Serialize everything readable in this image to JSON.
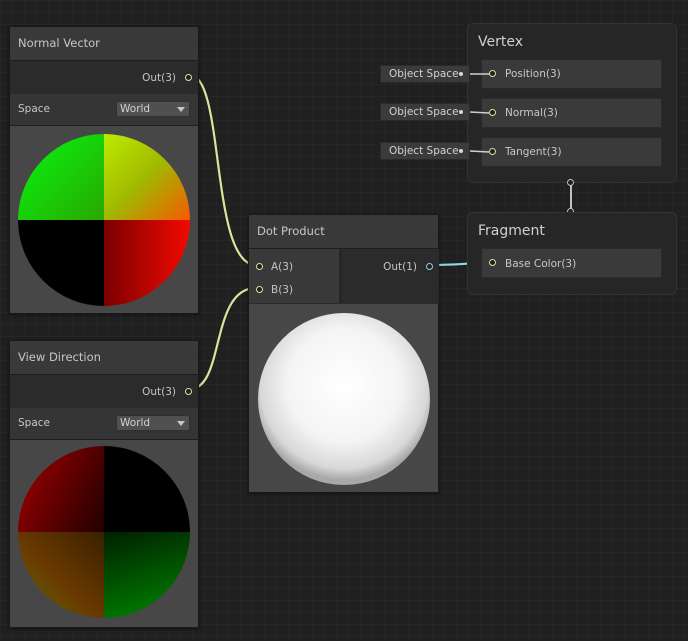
{
  "nodes": {
    "normal_vector": {
      "title": "Normal Vector",
      "output_label": "Out(3)",
      "space_label": "Space",
      "space_value": "World"
    },
    "view_direction": {
      "title": "View Direction",
      "output_label": "Out(3)",
      "space_label": "Space",
      "space_value": "World"
    },
    "dot_product": {
      "title": "Dot Product",
      "input_a": "A(3)",
      "input_b": "B(3)",
      "output_label": "Out(1)"
    }
  },
  "contexts": {
    "vertex": {
      "title": "Vertex",
      "blocks": [
        {
          "label": "Position(3)",
          "input_value": "Object Space"
        },
        {
          "label": "Normal(3)",
          "input_value": "Object Space"
        },
        {
          "label": "Tangent(3)",
          "input_value": "Object Space"
        }
      ]
    },
    "fragment": {
      "title": "Fragment",
      "blocks": [
        {
          "label": "Base Color(3)"
        }
      ]
    }
  },
  "colors": {
    "vector3_port": "#d6e69a",
    "float_port": "#8fd6e6",
    "background": "#202020"
  }
}
